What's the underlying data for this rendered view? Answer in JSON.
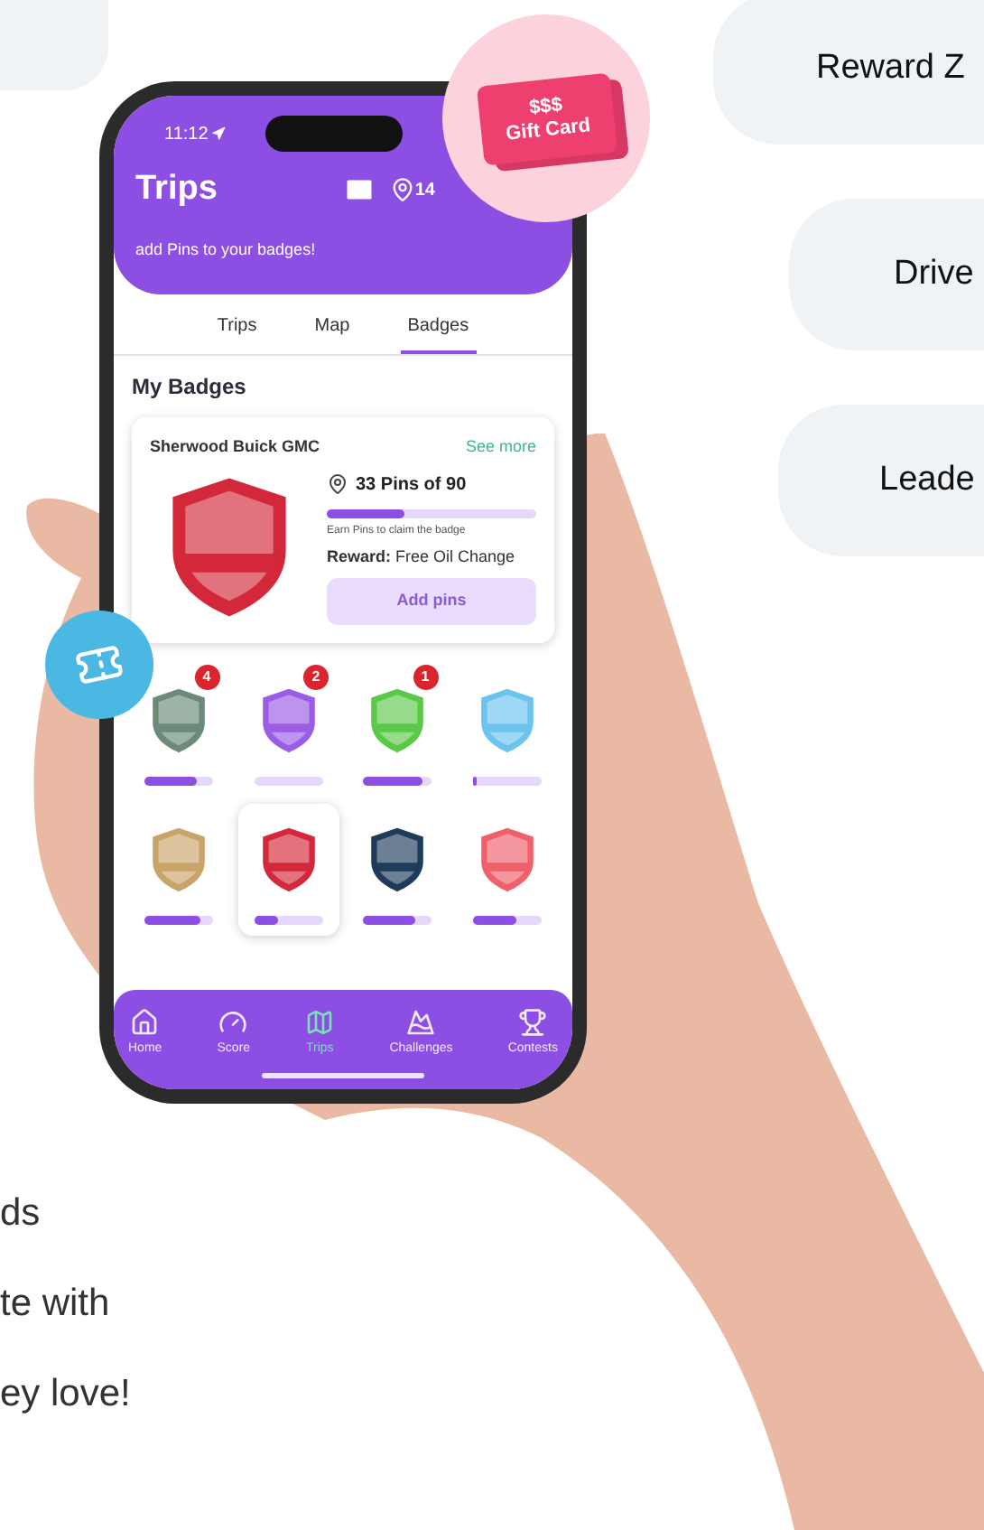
{
  "feature_pills": [
    {
      "label": "Reward Z"
    },
    {
      "label": "Drive"
    },
    {
      "label": "Leade"
    }
  ],
  "body_text": [
    "ds",
    "te with",
    "ey love!"
  ],
  "gift_card": {
    "line1": "$$$",
    "line2": "Gift Card"
  },
  "phone": {
    "status_time": "11:12",
    "title": "Trips",
    "pin_count": "14",
    "subtitle": "add Pins to your badges!",
    "tabs": [
      {
        "label": "Trips",
        "selected": false
      },
      {
        "label": "Map",
        "selected": false
      },
      {
        "label": "Badges",
        "selected": true
      }
    ],
    "section_title": "My Badges",
    "featured": {
      "dealer": "Sherwood Buick GMC",
      "link": "See more",
      "pins": "33 Pins of 90",
      "level": 0.37,
      "hint": "Earn Pins to claim the badge",
      "reward": "**Reward:** Free Oil Change",
      "button": "Add pins",
      "disabled": true,
      "color": "#d3283a"
    },
    "badges": [
      {
        "color": "#6b8a7a",
        "count": "4",
        "level": 0.75,
        "selected": false
      },
      {
        "color": "#9b5de5",
        "count": "2",
        "level": 0,
        "selected": false
      },
      {
        "color": "#5cc84a",
        "count": "1",
        "level": 0.85,
        "selected": false
      },
      {
        "color": "#6cc4ee",
        "level": 0.05,
        "selected": false
      },
      {
        "color": "#c9a46a",
        "level": 0.8,
        "selected": false
      },
      {
        "color": "#d3283a",
        "level": 0.35,
        "selected": true
      },
      {
        "color": "#1f3b5c",
        "level": 0.75,
        "selected": false
      },
      {
        "color": "#f0606a",
        "level": 0.65,
        "selected": false
      }
    ],
    "nav": [
      {
        "label": "Home",
        "selected": false
      },
      {
        "label": "Score",
        "selected": false
      },
      {
        "label": "Trips",
        "selected": true
      },
      {
        "label": "Challenges",
        "selected": false
      },
      {
        "label": "Contests",
        "selected": false
      }
    ]
  }
}
